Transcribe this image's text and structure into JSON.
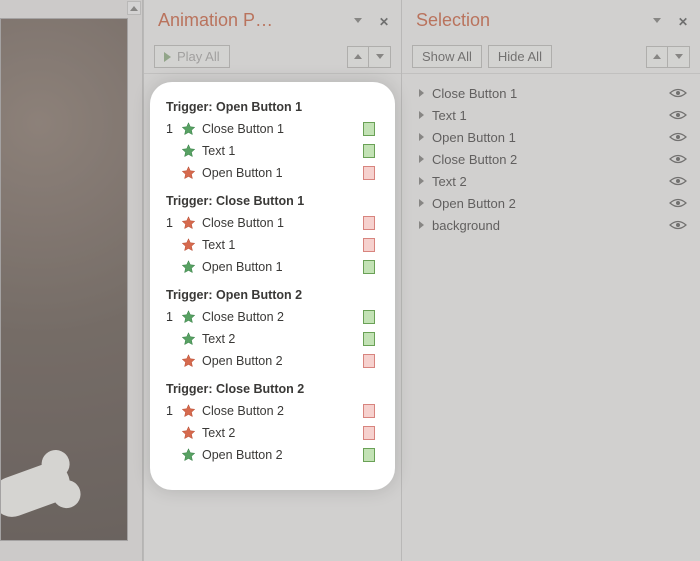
{
  "animationPane": {
    "title": "Animation P…",
    "playAllLabel": "Play All",
    "triggers": [
      {
        "title": "Trigger: Open Button 1",
        "items": [
          {
            "num": "1",
            "color": "green",
            "label": "Close Button 1",
            "swatch": "green"
          },
          {
            "num": "",
            "color": "green",
            "label": "Text 1",
            "swatch": "green"
          },
          {
            "num": "",
            "color": "red",
            "label": "Open Button 1",
            "swatch": "red"
          }
        ]
      },
      {
        "title": "Trigger: Close Button 1",
        "items": [
          {
            "num": "1",
            "color": "red",
            "label": "Close Button 1",
            "swatch": "red"
          },
          {
            "num": "",
            "color": "red",
            "label": "Text 1",
            "swatch": "red"
          },
          {
            "num": "",
            "color": "green",
            "label": "Open Button 1",
            "swatch": "green"
          }
        ]
      },
      {
        "title": "Trigger: Open Button 2",
        "items": [
          {
            "num": "1",
            "color": "green",
            "label": "Close Button 2",
            "swatch": "green"
          },
          {
            "num": "",
            "color": "green",
            "label": "Text 2",
            "swatch": "green"
          },
          {
            "num": "",
            "color": "red",
            "label": "Open Button 2",
            "swatch": "red"
          }
        ]
      },
      {
        "title": "Trigger: Close Button 2",
        "items": [
          {
            "num": "1",
            "color": "red",
            "label": "Close Button 2",
            "swatch": "red"
          },
          {
            "num": "",
            "color": "red",
            "label": "Text 2",
            "swatch": "red"
          },
          {
            "num": "",
            "color": "green",
            "label": "Open Button 2",
            "swatch": "green"
          }
        ]
      }
    ]
  },
  "selectionPane": {
    "title": "Selection",
    "showAllLabel": "Show All",
    "hideAllLabel": "Hide All",
    "items": [
      {
        "label": "Close Button 1"
      },
      {
        "label": "Text 1"
      },
      {
        "label": "Open Button 1"
      },
      {
        "label": "Close Button 2"
      },
      {
        "label": "Text 2"
      },
      {
        "label": "Open Button 2"
      },
      {
        "label": "background"
      }
    ]
  }
}
